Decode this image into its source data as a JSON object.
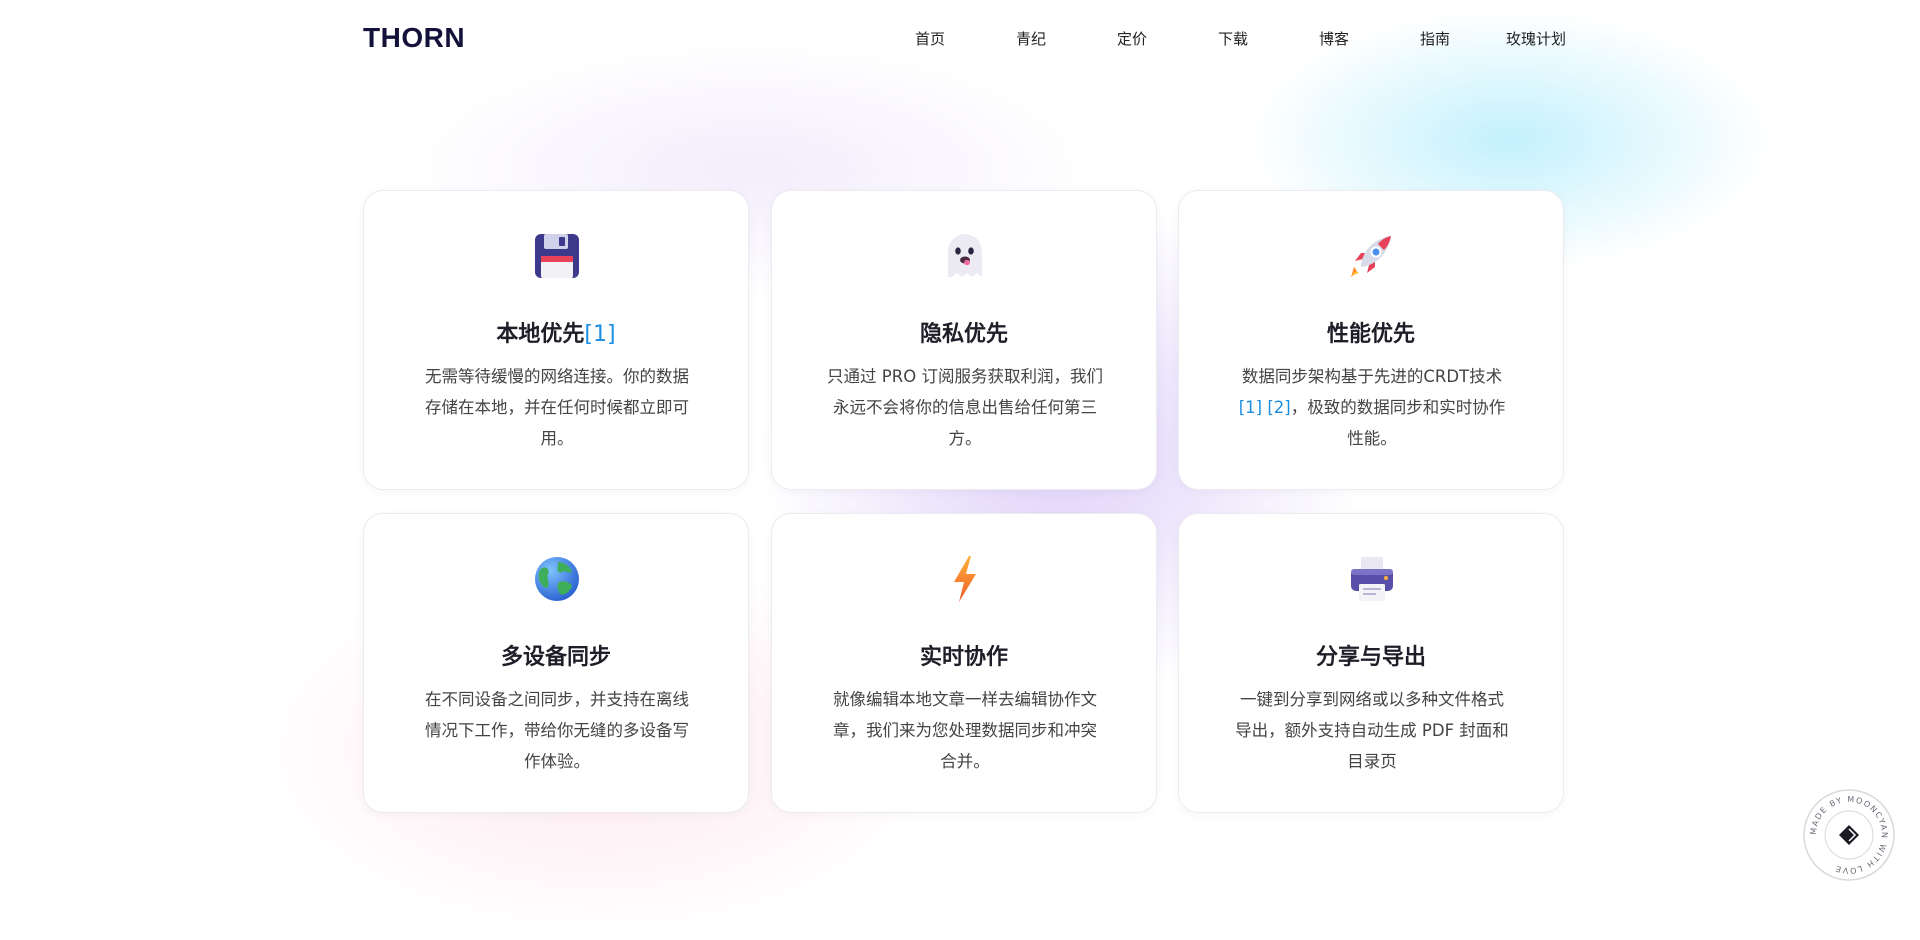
{
  "header": {
    "logo": "THORN",
    "nav": [
      "首页",
      "青纪",
      "定价",
      "下载",
      "博客",
      "指南",
      "玫瑰计划"
    ]
  },
  "features": [
    {
      "icon": "floppy-disk-icon",
      "title": "本地优先",
      "title_ref": "[1]",
      "desc": "无需等待缓慢的网络连接。你的数据存储在本地，并在任何时候都立即可用。"
    },
    {
      "icon": "ghost-icon",
      "title": "隐私优先",
      "desc": "只通过 PRO 订阅服务获取利润，我们永远不会将你的信息出售给任何第三方。"
    },
    {
      "icon": "rocket-icon",
      "title": "性能优先",
      "desc_before": "数据同步架构基于先进的CRDT技术",
      "desc_ref": "[1] [2]",
      "desc_after": "，极致的数据同步和实时协作性能。"
    },
    {
      "icon": "globe-icon",
      "title": "多设备同步",
      "desc": "在不同设备之间同步，并支持在离线情况下工作，带给你无缝的多设备写作体验。"
    },
    {
      "icon": "lightning-icon",
      "title": "实时协作",
      "desc": "就像编辑本地文章一样去编辑协作文章，我们来为您处理数据同步和冲突合并。"
    },
    {
      "icon": "printer-icon",
      "title": "分享与导出",
      "desc": "一键到分享到网络或以多种文件格式导出，额外支持自动生成 PDF 封面和目录页"
    }
  ],
  "badge": {
    "text": "MADE BY MOONCYAN WITH LOVE",
    "icon": "diamond-logo-icon"
  },
  "colors": {
    "logo": "#14123a",
    "ref_link": "#1a8fe0",
    "card_border": "#ececf0"
  }
}
